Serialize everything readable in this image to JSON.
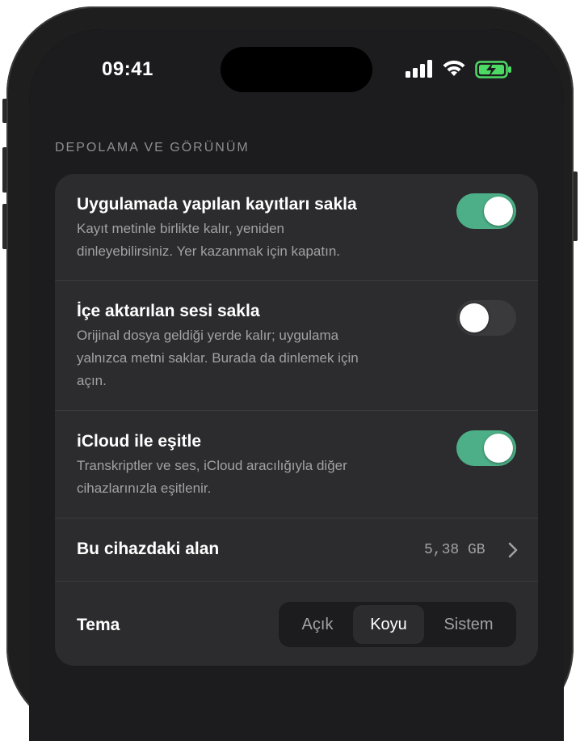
{
  "status_bar": {
    "time": "09:41",
    "icons": [
      "signal-icon",
      "wifi-icon",
      "battery-charging-icon"
    ],
    "battery_color": "#4cd964"
  },
  "section": {
    "title": "DEPOLAMA VE GÖRÜNÜM"
  },
  "settings": {
    "keep_recordings": {
      "title": "Uygulamada yapılan kayıtları sakla",
      "description_lines": [
        "Kayıt metinle birlikte kalır, yeniden",
        "dinleyebilirsiniz. Yer kazanmak için kapatın."
      ],
      "enabled": true
    },
    "keep_imported": {
      "title": "İçe aktarılan sesi sakla",
      "description_lines": [
        "Orijinal dosya geldiği yerde kalır; uygulama",
        "yalnızca metni saklar. Burada da dinlemek için",
        "açın."
      ],
      "enabled": false
    },
    "icloud_sync": {
      "title": "iCloud ile eşitle",
      "description_lines": [
        "Transkriptler ve ses, iCloud aracılığıyla diğer",
        "cihazlarınızla eşitlenir."
      ],
      "enabled": true
    },
    "storage": {
      "title": "Bu cihazdaki alan",
      "value": "5,38 GB"
    },
    "theme": {
      "title": "Tema",
      "options": [
        "Açık",
        "Koyu",
        "Sistem"
      ],
      "selected": "Koyu"
    }
  },
  "colors": {
    "accent_toggle": "#4caf87",
    "card_background": "#2c2c2e",
    "screen_background": "#1c1c1e"
  }
}
